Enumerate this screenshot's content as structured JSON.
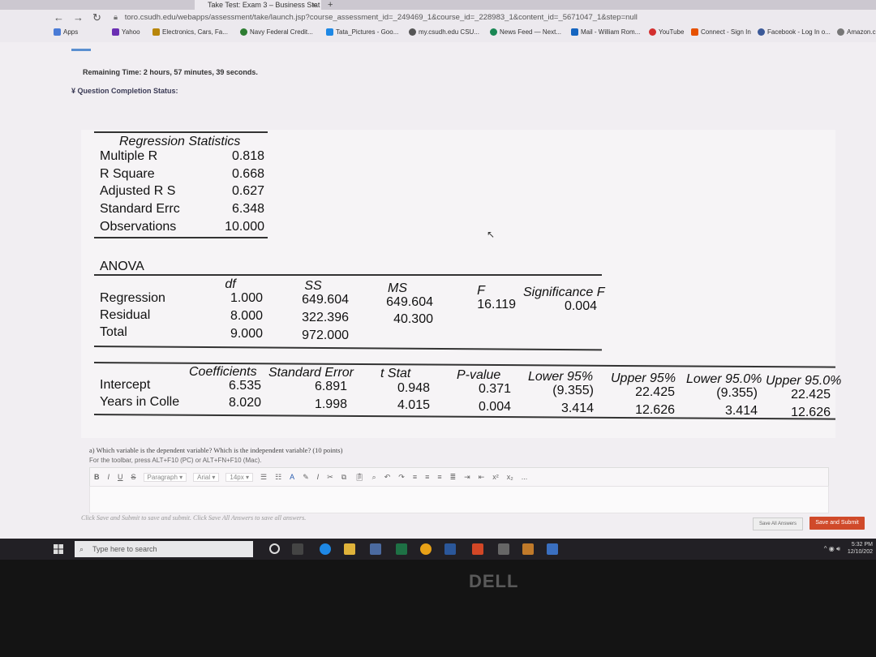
{
  "browser": {
    "tab_title": "Take Test: Exam 3 – Business Stat",
    "tab_close": "×",
    "new_tab": "+",
    "url": "toro.csudh.edu/webapps/assessment/take/launch.jsp?course_assessment_id=_249469_1&course_id=_228983_1&content_id=_5671047_1&step=null",
    "bookmarks": [
      {
        "label": "Apps",
        "color": "#4a7bd6"
      },
      {
        "label": "Yahoo",
        "color": "#6b2fb3"
      },
      {
        "label": "Electronics, Cars, Fa...",
        "color": "#b8860b"
      },
      {
        "label": "Navy Federal Credit...",
        "color": "#2e7d32"
      },
      {
        "label": "Tata_Pictures - Goo...",
        "color": "#1e88e5"
      },
      {
        "label": "my.csudh.edu CSU...",
        "color": "#555555"
      },
      {
        "label": "News Feed — Next...",
        "color": "#1a8754"
      },
      {
        "label": "Mail - William Rom...",
        "color": "#1565c0"
      },
      {
        "label": "YouTube",
        "color": "#d32f2f"
      },
      {
        "label": "Connect - Sign In",
        "color": "#e65100"
      },
      {
        "label": "Facebook - Log In o...",
        "color": "#3b5998"
      },
      {
        "label": "Amazon.co",
        "color": "#777777"
      }
    ]
  },
  "test": {
    "remaining_time": "Remaining Time: 2 hours, 57 minutes, 39 seconds.",
    "question_status": "Question Completion Status:"
  },
  "regression": {
    "stats_title": "Regression Statistics",
    "stats": [
      {
        "label": "Multiple R",
        "value": "0.818"
      },
      {
        "label": "R Square",
        "value": "0.668"
      },
      {
        "label": "Adjusted R S",
        "value": "0.627"
      },
      {
        "label": "Standard Errc",
        "value": "6.348"
      },
      {
        "label": "Observations",
        "value": "10.000"
      }
    ],
    "anova_title": "ANOVA",
    "anova_headers": {
      "df": "df",
      "ss": "SS",
      "ms": "MS",
      "f": "F",
      "sig": "Significance F"
    },
    "anova_rows": [
      {
        "label": "Regression",
        "df": "1.000",
        "ss": "649.604",
        "ms": "649.604",
        "f": "16.119",
        "sig": "0.004"
      },
      {
        "label": "Residual",
        "df": "8.000",
        "ss": "322.396",
        "ms": "40.300",
        "f": "",
        "sig": ""
      },
      {
        "label": "Total",
        "df": "9.000",
        "ss": "972.000",
        "ms": "",
        "f": "",
        "sig": ""
      }
    ],
    "coef_headers": {
      "coef": "Coefficients",
      "se": "Standard Error",
      "t": "t Stat",
      "p": "P-value",
      "l95": "Lower 95%",
      "u95": "Upper 95%",
      "l950": "Lower 95.0%",
      "u950": "Upper 95.0%"
    },
    "coef_rows": [
      {
        "label": "Intercept",
        "coef": "6.535",
        "se": "6.891",
        "t": "0.948",
        "p": "0.371",
        "l95": "(9.355)",
        "u95": "22.425",
        "l950": "(9.355)",
        "u950": "22.425"
      },
      {
        "label": "Years in Colle",
        "coef": "8.020",
        "se": "1.998",
        "t": "4.015",
        "p": "0.004",
        "l95": "3.414",
        "u95": "12.626",
        "l950": "3.414",
        "u950": "12.626"
      }
    ]
  },
  "question": {
    "text": "a) Which variable is the dependent variable? Which is the independent variable? (10 points)",
    "hint": "For the toolbar, press ALT+F10 (PC) or ALT+FN+F10 (Mac).",
    "toolbar": {
      "bold": "B",
      "italic": "I",
      "underline": "U",
      "strike": "S",
      "paragraph": "Paragraph",
      "font": "Arial",
      "size": "14px",
      "superscript": "x²",
      "subscript": "x₂",
      "more": "..."
    }
  },
  "footer": {
    "instructions": "Click Save and Submit to save and submit. Click Save All Answers to save all answers.",
    "save_all": "Save All Answers",
    "save_submit": "Save and Submit"
  },
  "taskbar": {
    "search_placeholder": "Type here to search",
    "time": "5:32 PM",
    "date": "12/10/202"
  },
  "monitor_brand": "DELL"
}
